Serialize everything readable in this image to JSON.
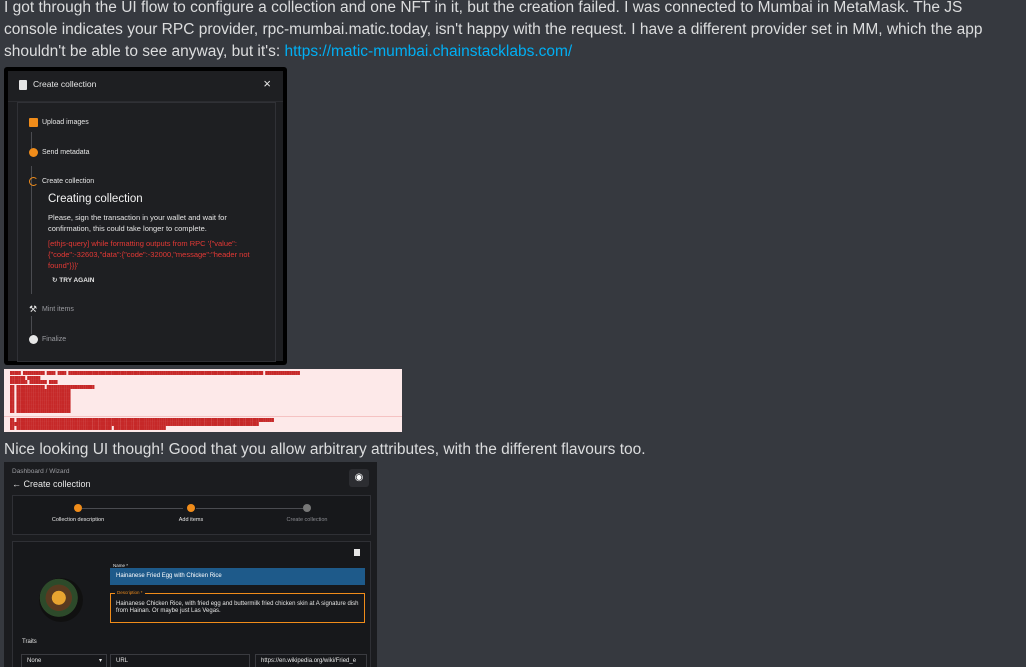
{
  "message1": {
    "text": "I got through the UI flow to configure a collection and one NFT in it, but the creation failed. I was connected to Mumbai in MetaMask. The JS console indicates your RPC provider, rpc-mumbai.matic.today, isn't happy with the request. I have a different provider set in MM, which the app shouldn't be able to see anyway, but it's: ",
    "link": "https://matic-mumbai.chainstacklabs.com/"
  },
  "message2": {
    "text": "Nice looking UI though! Good that you allow arbitrary attributes, with the different flavours too."
  },
  "dialog": {
    "title": "Create collection",
    "close": "×",
    "steps": [
      {
        "label": "Upload images"
      },
      {
        "label": "Send metadata"
      },
      {
        "label": "Create collection"
      },
      {
        "label": "Mint items"
      },
      {
        "label": "Finalize"
      }
    ],
    "creating_title": "Creating collection",
    "creating_body": "Please, sign the transaction in your wallet and wait for confirmation, this could take longer to complete.",
    "error": "[ethjs-query] while formatting outputs from RPC '{\"value\":{\"code\":-32603,\"data\":{\"code\":-32000,\"message\":\"header not found\"}}}'",
    "retry": "TRY AGAIN"
  },
  "wizard": {
    "breadcrumb": "Dashboard / Wizard",
    "title": "Create collection",
    "steps": [
      {
        "label": "Collection description"
      },
      {
        "label": "Add items"
      },
      {
        "label": "Create collection"
      }
    ],
    "name_label": "Name *",
    "name_value": "Hainanese Fried Egg with Chicken Rice",
    "desc_label": "Description *",
    "desc_value": "Hainanese Chicken Rice, with fried egg and buttermilk fried chicken skin at A signature dish from Hainan. Or maybe just Las Vegas.",
    "traits_label": "Traits",
    "trait_type": "None",
    "trait_key": "URL",
    "trait_value": "https://en.wikipedia.org/wiki/Fried_e"
  }
}
